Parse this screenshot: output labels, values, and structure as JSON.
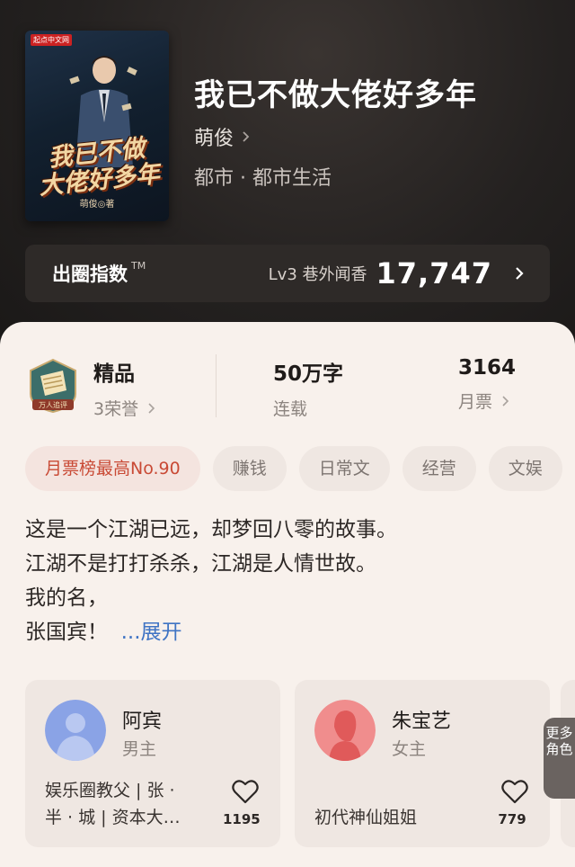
{
  "book": {
    "cover": {
      "publisher": "起点中文网",
      "title_line1": "我已不做",
      "title_line2": "大佬好多年",
      "author_sig": "萌俊◎著"
    },
    "title": "我已不做大佬好多年",
    "author": "萌俊",
    "genre": "都市 · 都市生活"
  },
  "influence": {
    "label": "出圈指数",
    "tm": "TM",
    "level": "Lv3 巷外闻香",
    "score": "17,747"
  },
  "stats": {
    "badge_text": "万人追评",
    "quality": "精品",
    "honors": "3荣誉",
    "words": "50万字",
    "status": "连载",
    "tickets": "3164",
    "tickets_label": "月票"
  },
  "tags": [
    "月票榜最高No.90",
    "赚钱",
    "日常文",
    "经营",
    "文娱"
  ],
  "description": {
    "lines": [
      "这是一个江湖已远，却梦回八零的故事。",
      "江湖不是打打杀杀，江湖是人情世故。",
      "我的名，",
      "张国宾！"
    ],
    "more": "...展开"
  },
  "characters": [
    {
      "name": "阿宾",
      "role": "男主",
      "bio_line1": "娱乐圈教父 | 张 ·",
      "bio_line2": "半 · 城 | 资本大…",
      "likes": "1195"
    },
    {
      "name": "朱宝艺",
      "role": "女主",
      "bio_line1": "初代神仙姐姐",
      "bio_line2": "",
      "likes": "779"
    }
  ],
  "more_roles": "更多角色",
  "colors": {
    "accent_red": "#c94a35",
    "link_blue": "#3f74c4",
    "male_avatar": "#8aa3e6",
    "female_avatar": "#f08d8d"
  }
}
